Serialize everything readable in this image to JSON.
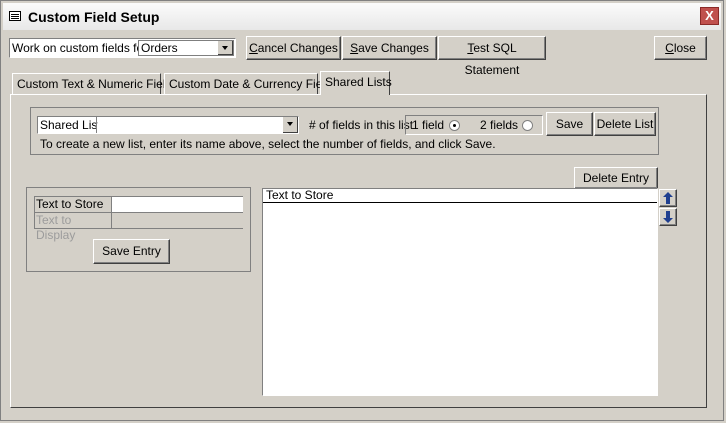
{
  "window": {
    "title": "Custom Field Setup",
    "close_glyph": "X"
  },
  "toolbar": {
    "work_on_label": "Work on custom fields for:",
    "work_on_value": "Orders",
    "cancel_changes": "Cancel Changes",
    "save_changes": "Save Changes",
    "test_sql": "Test SQL Statement",
    "close": "Close"
  },
  "tabs": [
    {
      "label": "Custom Text & Numeric Fields"
    },
    {
      "label": "Custom Date & Currency Fields"
    },
    {
      "label": "Shared Lists",
      "active": true
    }
  ],
  "shared_list": {
    "label": "Shared List",
    "value": "",
    "num_fields_label": "# of fields in this list",
    "option_1": "1 field",
    "option_2": "2 fields",
    "selected": "1 field",
    "save": "Save",
    "delete_list": "Delete List",
    "hint": "To create a new list, enter its name above, select the number of fields, and click Save."
  },
  "entry_form": {
    "text_to_store_label": "Text to Store",
    "text_to_store_value": "",
    "text_to_display_label": "Text to Display",
    "text_to_display_value": "",
    "save_entry": "Save Entry"
  },
  "entries": {
    "delete_entry": "Delete Entry",
    "column_header": "Text to Store",
    "rows": []
  },
  "icons": {
    "move_up": "arrow-up-icon",
    "move_down": "arrow-down-icon"
  }
}
